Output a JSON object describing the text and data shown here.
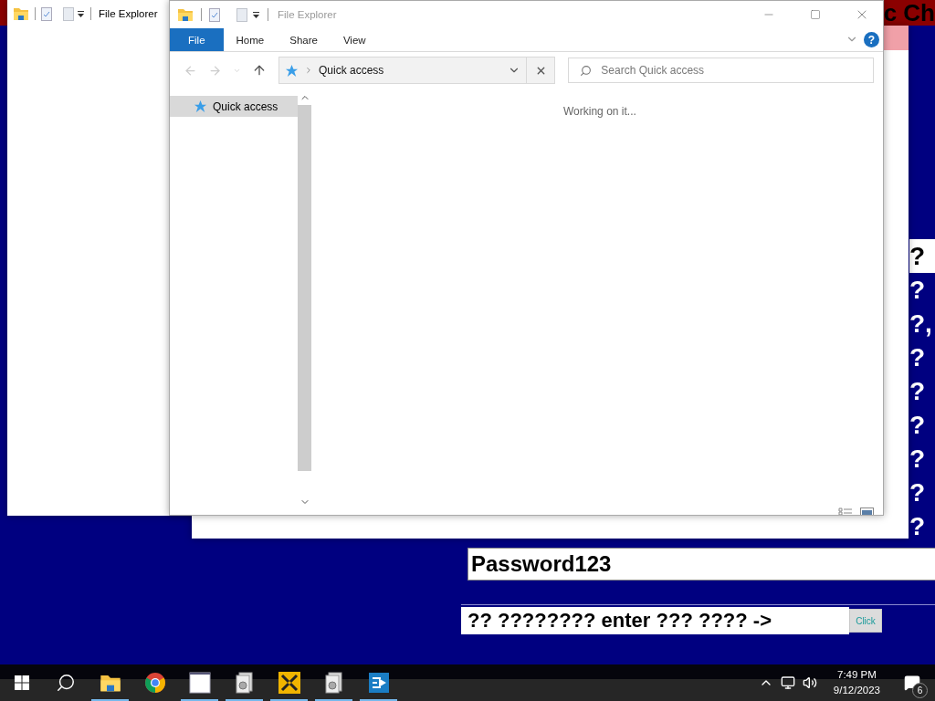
{
  "background_app": {
    "header_text": "c Ch",
    "side_lines": [
      {
        "text": "?",
        "kind": "light"
      },
      {
        "text": "?",
        "kind": "dark"
      },
      {
        "text": "?,",
        "kind": "dark"
      },
      {
        "text": "?",
        "kind": "dark"
      },
      {
        "text": "?",
        "kind": "dark"
      },
      {
        "text": "?",
        "kind": "dark"
      },
      {
        "text": "?",
        "kind": "dark"
      },
      {
        "text": "?",
        "kind": "dark"
      },
      {
        "text": "?",
        "kind": "dark"
      }
    ],
    "password_value": "Password123",
    "prompt_value": "?? ???????? enter ??? ???? ->",
    "button": "Click"
  },
  "back_window": {
    "title": "File Explorer"
  },
  "explorer": {
    "title": "File Explorer",
    "ribbon_tabs": [
      {
        "label": "File",
        "selected": true
      },
      {
        "label": "Home",
        "selected": false
      },
      {
        "label": "Share",
        "selected": false
      },
      {
        "label": "View",
        "selected": false
      }
    ],
    "help_label": "?",
    "address": "Quick access",
    "search": {
      "placeholder": "Search Quick access"
    },
    "nav": [
      {
        "label": "Quick access",
        "selected": true
      }
    ],
    "status": "Working on it..."
  },
  "taskbar": {
    "apps": [
      {
        "kind": "folder",
        "running": true
      },
      {
        "kind": "chrome",
        "running": false
      },
      {
        "kind": "window",
        "running": true
      },
      {
        "kind": "doc-gear",
        "running": true
      },
      {
        "kind": "arrows",
        "running": true
      },
      {
        "kind": "doc-gear",
        "running": true
      },
      {
        "kind": "remote",
        "running": true
      }
    ],
    "time": "7:49 PM",
    "date": "9/12/2023",
    "notifications": "6"
  }
}
